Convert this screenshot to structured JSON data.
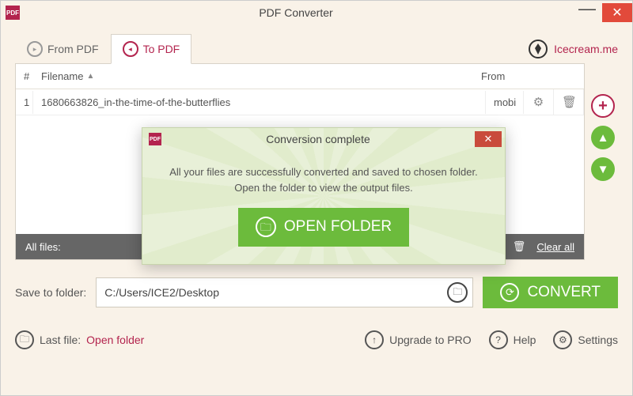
{
  "window": {
    "title": "PDF Converter"
  },
  "tabs": {
    "from_pdf": "From PDF",
    "to_pdf": "To PDF"
  },
  "brand": "Icecream.me",
  "table": {
    "headers": {
      "num": "#",
      "filename": "Filename",
      "from": "From"
    },
    "rows": [
      {
        "num": "1",
        "name": "1680663826_in-the-time-of-the-butterflies",
        "from": "mobi"
      }
    ]
  },
  "allfiles": {
    "label": "All files:",
    "clear": "Clear all"
  },
  "save": {
    "label": "Save to folder:",
    "path": "C:/Users/ICE2/Desktop"
  },
  "convert": "CONVERT",
  "footer": {
    "lastfile_label": "Last file:",
    "lastfile_link": "Open folder",
    "upgrade": "Upgrade to PRO",
    "help": "Help",
    "settings": "Settings"
  },
  "modal": {
    "title": "Conversion complete",
    "line1": "All your files are successfully converted and saved to chosen folder.",
    "line2": "Open the folder to view the output files.",
    "open": "OPEN FOLDER"
  }
}
